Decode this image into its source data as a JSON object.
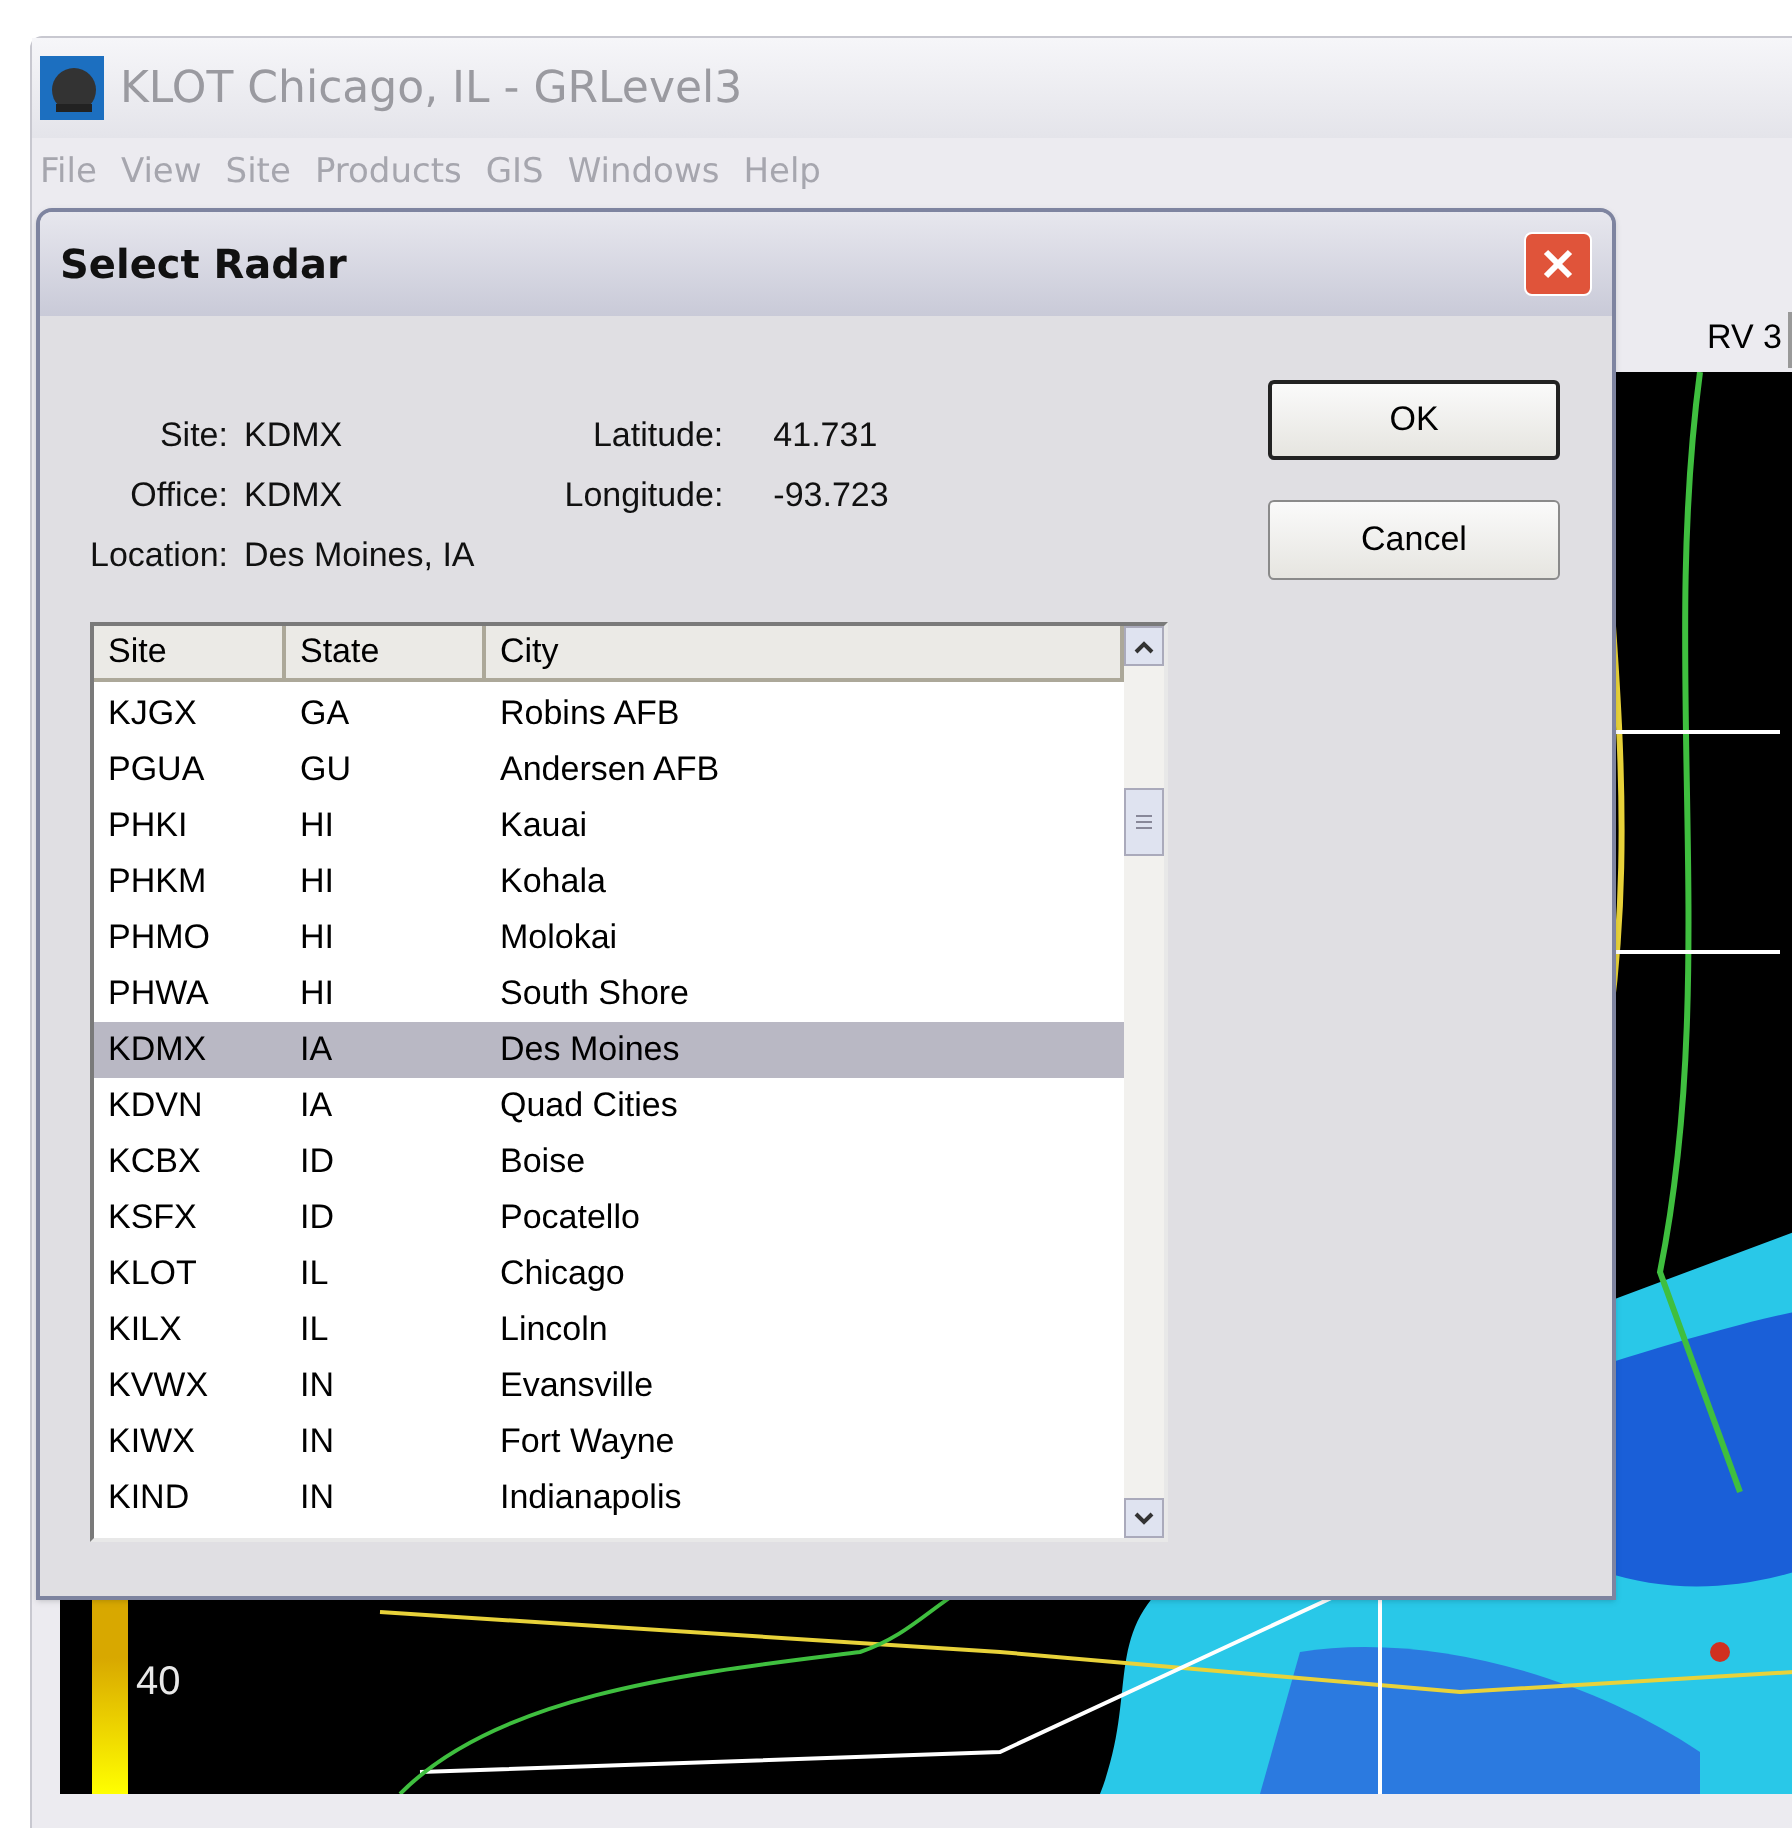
{
  "window": {
    "title": "KLOT Chicago, IL - GRLevel3"
  },
  "menu": [
    {
      "label": "File",
      "disabled": true
    },
    {
      "label": "View",
      "disabled": true
    },
    {
      "label": "Site",
      "disabled": true
    },
    {
      "label": "Products",
      "disabled": true
    },
    {
      "label": "GIS",
      "disabled": true
    },
    {
      "label": "Windows",
      "disabled": true
    },
    {
      "label": "Help",
      "disabled": true
    }
  ],
  "tabs": [
    {
      "label": "RV 3"
    }
  ],
  "legend": {
    "labels": [
      "40"
    ]
  },
  "dialog": {
    "title": "Select Radar",
    "info_left": [
      {
        "label": "Site:",
        "value": "KDMX"
      },
      {
        "label": "Office:",
        "value": "KDMX"
      },
      {
        "label": "Location:",
        "value": "Des Moines, IA"
      }
    ],
    "info_right": [
      {
        "label": "Latitude:",
        "value": "41.731"
      },
      {
        "label": "Longitude:",
        "value": "-93.723"
      }
    ],
    "buttons": [
      {
        "label": "OK",
        "default": true
      },
      {
        "label": "Cancel",
        "default": false
      }
    ],
    "list": {
      "columns": [
        "Site",
        "State",
        "City"
      ],
      "rows": [
        {
          "cells": [
            "KJGX",
            "GA",
            "Robins AFB"
          ],
          "selected": false
        },
        {
          "cells": [
            "PGUA",
            "GU",
            "Andersen AFB"
          ],
          "selected": false
        },
        {
          "cells": [
            "PHKI",
            "HI",
            "Kauai"
          ],
          "selected": false
        },
        {
          "cells": [
            "PHKM",
            "HI",
            "Kohala"
          ],
          "selected": false
        },
        {
          "cells": [
            "PHMO",
            "HI",
            "Molokai"
          ],
          "selected": false
        },
        {
          "cells": [
            "PHWA",
            "HI",
            "South Shore"
          ],
          "selected": false
        },
        {
          "cells": [
            "KDMX",
            "IA",
            "Des Moines"
          ],
          "selected": true
        },
        {
          "cells": [
            "KDVN",
            "IA",
            "Quad Cities"
          ],
          "selected": false
        },
        {
          "cells": [
            "KCBX",
            "ID",
            "Boise"
          ],
          "selected": false
        },
        {
          "cells": [
            "KSFX",
            "ID",
            "Pocatello"
          ],
          "selected": false
        },
        {
          "cells": [
            "KLOT",
            "IL",
            "Chicago"
          ],
          "selected": false
        },
        {
          "cells": [
            "KILX",
            "IL",
            "Lincoln"
          ],
          "selected": false
        },
        {
          "cells": [
            "KVWX",
            "IN",
            "Evansville"
          ],
          "selected": false
        },
        {
          "cells": [
            "KIWX",
            "IN",
            "Fort Wayne"
          ],
          "selected": false
        },
        {
          "cells": [
            "KIND",
            "IN",
            "Indianapolis"
          ],
          "selected": false
        }
      ]
    }
  }
}
